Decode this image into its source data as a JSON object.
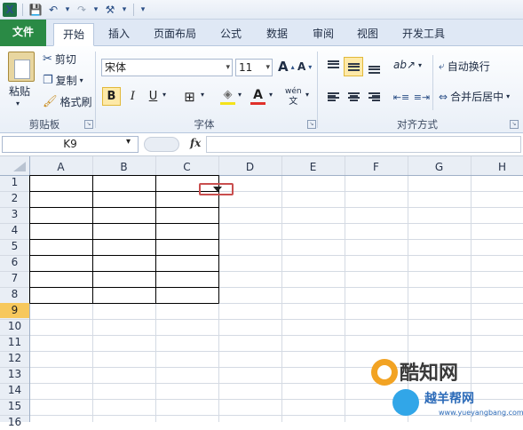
{
  "quick_access": {
    "app_icon": "X",
    "save_icon": "💾",
    "undo_icon": "↶",
    "redo_icon": "↷",
    "customize_icon": "⚒",
    "dropdown_icon": "▾"
  },
  "tabs": [
    {
      "label": "文件"
    },
    {
      "label": "开始"
    },
    {
      "label": "插入"
    },
    {
      "label": "页面布局"
    },
    {
      "label": "公式"
    },
    {
      "label": "数据"
    },
    {
      "label": "审阅"
    },
    {
      "label": "视图"
    },
    {
      "label": "开发工具"
    }
  ],
  "ribbon": {
    "clipboard": {
      "paste_label": "粘贴",
      "cut_label": "剪切",
      "copy_label": "复制",
      "format_painter_label": "格式刷",
      "group_label": "剪贴板"
    },
    "font": {
      "font_name": "宋体",
      "font_size": "11",
      "grow_label": "A",
      "shrink_label": "A",
      "bold_label": "B",
      "italic_label": "I",
      "underline_label": "U",
      "border_icon": "⊞",
      "fill_icon": "◈",
      "font_color_label": "A",
      "phonetic_label": "wén",
      "group_label": "字体",
      "fill_color": "#f5e31a",
      "font_color": "#e0302a"
    },
    "alignment": {
      "wrap_text_label": "自动换行",
      "merge_center_label": "合并后居中",
      "orientation_icon": "ab↗",
      "group_label": "对齐方式"
    }
  },
  "formula_bar": {
    "name_box": "K9",
    "fx_label": "fx",
    "formula": ""
  },
  "sheet": {
    "columns": [
      "A",
      "B",
      "C",
      "D",
      "E",
      "F",
      "G",
      "H"
    ],
    "rows": [
      "1",
      "2",
      "3",
      "4",
      "5",
      "6",
      "7",
      "8",
      "9",
      "10",
      "11",
      "12",
      "13",
      "14",
      "15",
      "16"
    ],
    "active_row": "9",
    "active_row_color": "#f7c85c",
    "highlight_color": "#c94e4e"
  },
  "watermark": {
    "title": "酷知网",
    "subtitle": "越羊帮网",
    "url": "www.yueyangbang.com"
  }
}
